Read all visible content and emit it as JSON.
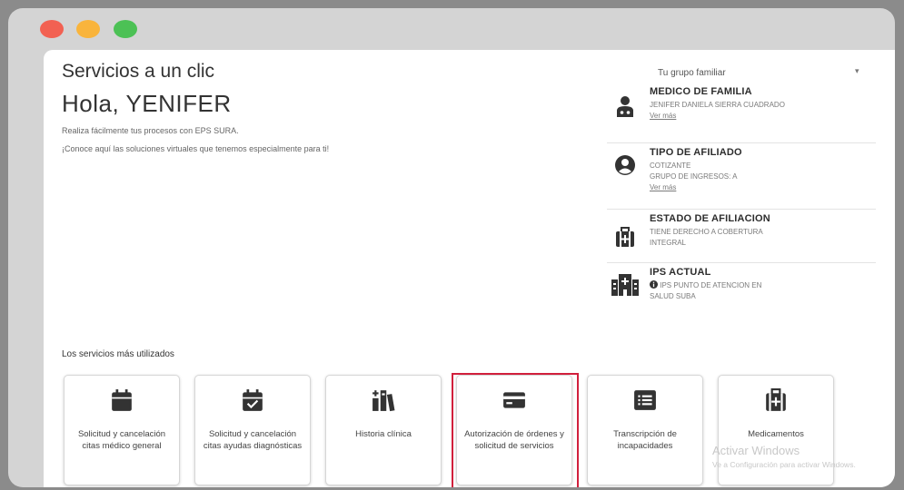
{
  "window": {
    "controls": [
      "close",
      "minimize",
      "maximize"
    ]
  },
  "header": {
    "title": "Servicios a un clic",
    "greeting": "Hola, YENIFER",
    "description_line1": "Realiza fácilmente tus procesos con EPS SURA.",
    "description_line2": "¡Conoce aquí las soluciones virtuales que tenemos especialmente para ti!"
  },
  "family_selector": {
    "value": "Tu grupo familiar",
    "arrow": "▾"
  },
  "info_cards": [
    {
      "icon": "doctor-icon",
      "title": "MEDICO DE FAMILIA",
      "line1": "JENIFER DANIELA SIERRA CUADRADO",
      "link": "Ver más"
    },
    {
      "icon": "user-circle-icon",
      "title": "TIPO DE AFILIADO",
      "line1": "COTIZANTE",
      "line2": "GRUPO DE INGRESOS: A",
      "link": "Ver más"
    },
    {
      "icon": "medical-case-icon",
      "title": "ESTADO DE AFILIACION",
      "line1": "TIENE DERECHO A COBERTURA",
      "line2": "INTEGRAL"
    },
    {
      "icon": "hospital-icon",
      "title": "IPS ACTUAL",
      "line1": "IPS PUNTO DE ATENCION EN",
      "line2": "SALUD SUBA"
    }
  ],
  "services": {
    "heading": "Los servicios más utilizados",
    "items": [
      {
        "icon": "calendar-icon",
        "label": "Solicitud y cancelación citas médico general"
      },
      {
        "icon": "calendar-check-icon",
        "label": "Solicitud y cancelación citas ayudas diagnósticas"
      },
      {
        "icon": "clinical-history-icon",
        "label": "Historia clínica"
      },
      {
        "icon": "card-icon",
        "label": "Autorización de órdenes y solicitud de servicios"
      },
      {
        "icon": "list-icon",
        "label": "Transcripción de incapacidades"
      },
      {
        "icon": "medicine-kit-icon",
        "label": "Medicamentos"
      }
    ]
  },
  "watermark": {
    "line1": "Activar Windows",
    "line2": "Ve a Configuración para activar Windows."
  },
  "colors": {
    "highlight": "#d11f3c",
    "frame": "#d4d4d4",
    "icon": "#333333"
  }
}
